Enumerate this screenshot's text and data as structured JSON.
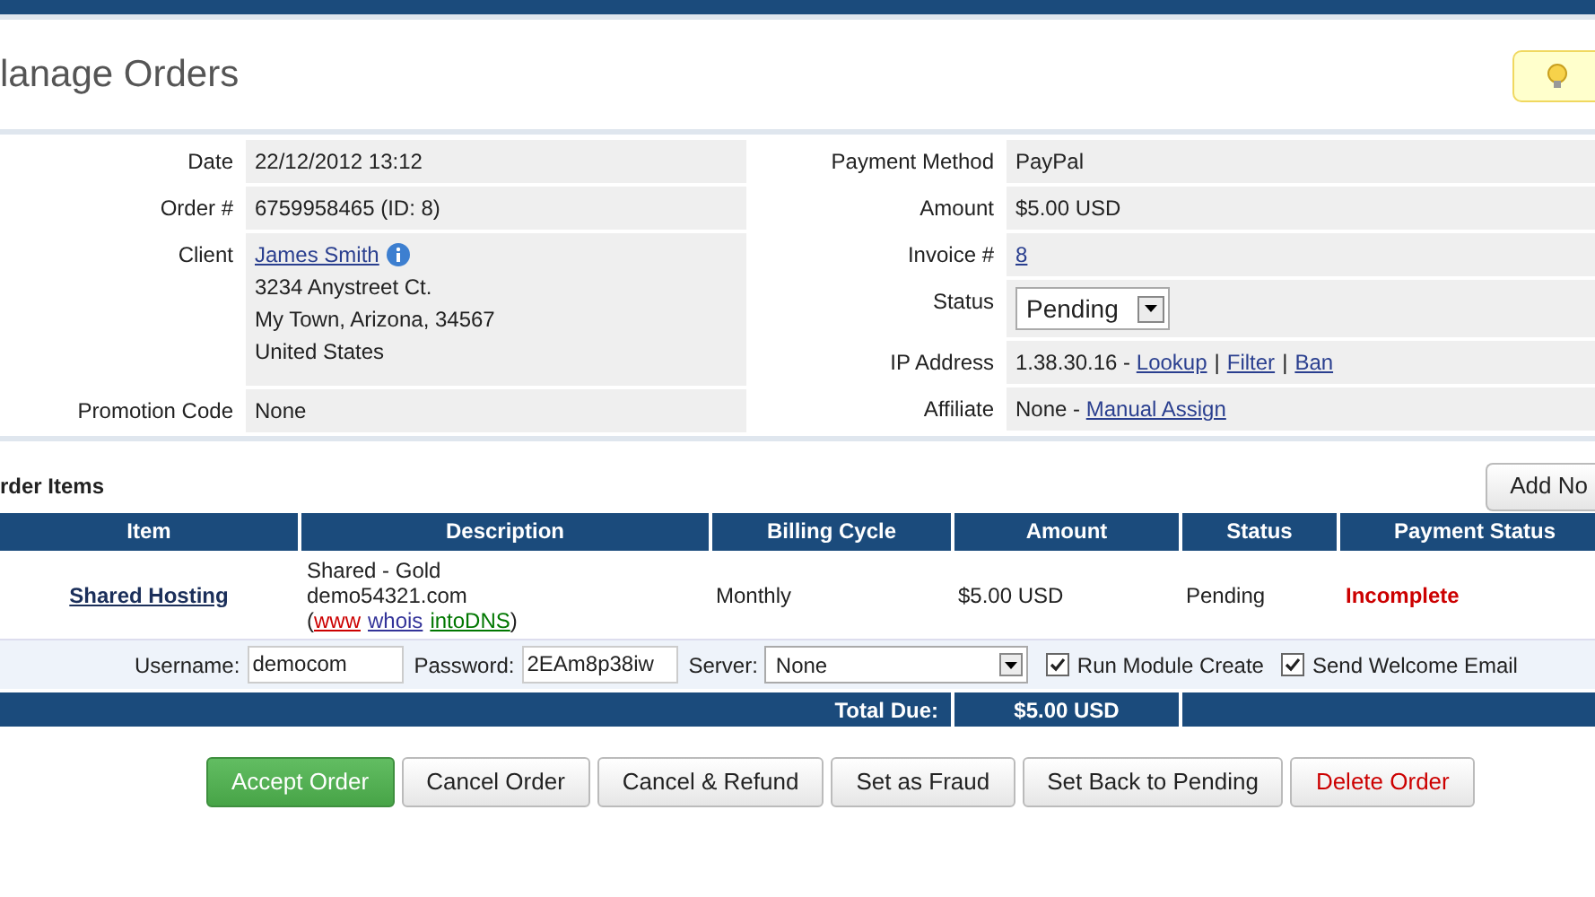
{
  "page_title": "lanage Orders",
  "details_left": [
    {
      "kind": "text",
      "label": "Date",
      "value": "22/12/2012 13:12"
    },
    {
      "kind": "text",
      "label": "Order #",
      "value": "6759958465 (ID: 8)"
    },
    {
      "kind": "client",
      "label": "Client",
      "link": "James Smith",
      "lines": [
        "3234 Anystreet Ct.",
        "My Town, Arizona, 34567",
        "United States"
      ]
    },
    {
      "kind": "text",
      "label": "Promotion Code",
      "value": "None"
    }
  ],
  "details_right": [
    {
      "kind": "text",
      "label": "Payment Method",
      "value": "PayPal"
    },
    {
      "kind": "text",
      "label": "Amount",
      "value": "$5.00 USD"
    },
    {
      "kind": "links",
      "label": "Invoice #",
      "links": [
        "8"
      ]
    },
    {
      "kind": "select",
      "label": "Status",
      "value": "Pending"
    },
    {
      "kind": "links",
      "label": "IP Address",
      "prefix": "1.38.30.16 - ",
      "links": [
        "Lookup",
        "Filter",
        "Ban"
      ],
      "separator": "|"
    },
    {
      "kind": "links",
      "label": "Affiliate",
      "prefix": "None - ",
      "links": [
        "Manual Assign"
      ]
    }
  ],
  "order_items": {
    "title": "rder Items",
    "add_button": "Add No",
    "columns": [
      "Item",
      "Description",
      "Billing Cycle",
      "Amount",
      "Status",
      "Payment Status"
    ],
    "rows": [
      {
        "item": "Shared Hosting",
        "description_lines": [
          "Shared - Gold",
          "demo54321.com"
        ],
        "link_open": "(",
        "link_close": ")",
        "links": [
          {
            "text": "www",
            "color": "#cc0000"
          },
          {
            "text": "whois",
            "color": "#333399"
          },
          {
            "text": "intoDNS",
            "color": "#007700"
          }
        ],
        "billing_cycle": "Monthly",
        "amount": "$5.00 USD",
        "status": "Pending",
        "payment_status": "Incomplete"
      }
    ],
    "config": [
      {
        "kind": "input",
        "label": "Username:",
        "value": "democom"
      },
      {
        "kind": "input",
        "label": "Password:",
        "value": "2EAm8p38iw"
      },
      {
        "kind": "select",
        "label": "Server:",
        "value": "None"
      },
      {
        "kind": "checkbox",
        "label": "Run Module Create",
        "checked": true
      },
      {
        "kind": "checkbox",
        "label": "Send Welcome Email",
        "checked": true
      }
    ],
    "total": {
      "label": "Total Due:",
      "value": "$5.00 USD"
    }
  },
  "actions": [
    {
      "label": "Accept Order",
      "kind": "primary"
    },
    {
      "label": "Cancel Order",
      "kind": "default"
    },
    {
      "label": "Cancel & Refund",
      "kind": "default"
    },
    {
      "label": "Set as Fraud",
      "kind": "default"
    },
    {
      "label": "Set Back to Pending",
      "kind": "default"
    },
    {
      "label": "Delete Order",
      "kind": "danger"
    }
  ]
}
